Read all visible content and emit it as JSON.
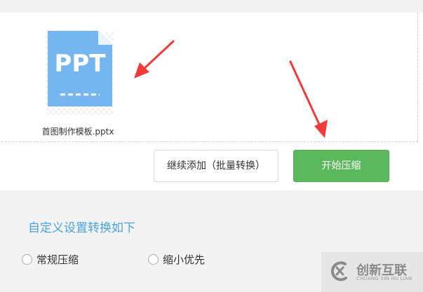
{
  "upload": {
    "file": {
      "icon": "ppt-file-icon",
      "icon_text": "PPT",
      "name": "首图制作模板.pptx"
    },
    "buttons": {
      "continue_add": "继续添加（批量转换）",
      "start_compress": "开始压缩"
    }
  },
  "settings": {
    "title": "自定义设置转换如下",
    "options": [
      {
        "label": "常规压缩"
      },
      {
        "label": "缩小优先"
      }
    ]
  },
  "annotations": {
    "arrows": [
      "red-arrow-to-file",
      "red-arrow-to-start-button"
    ],
    "color": "#f23a3a"
  },
  "watermark": {
    "main_text": "创新互联",
    "sub_text": "CHUANG XIN HU LIAN"
  },
  "colors": {
    "primary": "#5cb85c",
    "accent": "#4aa3df",
    "ppt_blue": "#76b6f0"
  }
}
